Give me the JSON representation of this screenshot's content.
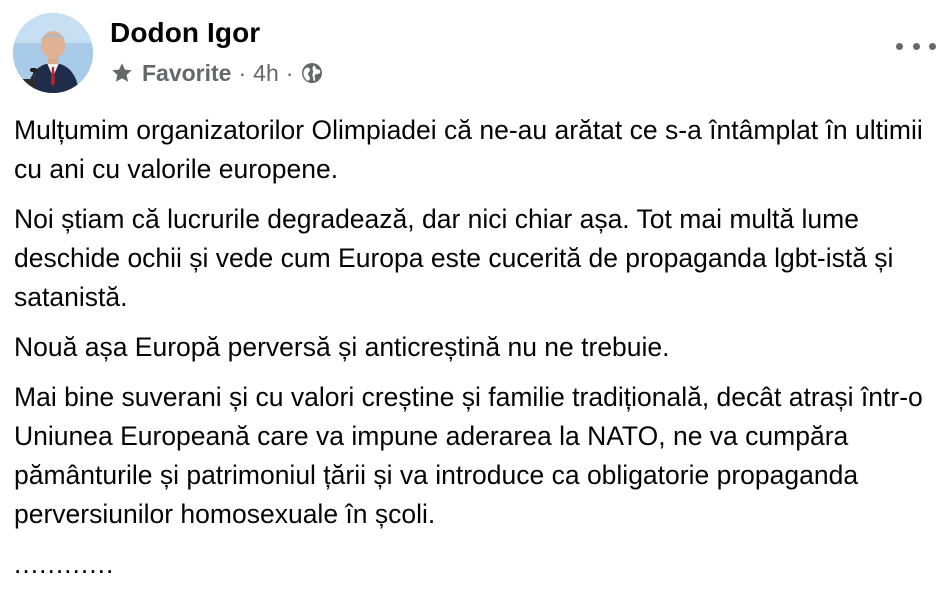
{
  "post": {
    "author": "Dodon Igor",
    "audience_label": "Favorite",
    "separator": "·",
    "time": "4h",
    "paragraphs": [
      "Mulțumim organizatorilor Olimpiadei că ne-au arătat ce s-a întâmplat în ultimii cu ani cu valorile europene.",
      "Noi știam că lucrurile degradează, dar nici chiar așa. Tot mai multă lume deschide ochii și vede cum Europa este cucerită de propaganda lgbt-istă și satanistă.",
      "Nouă așa Europă perversă și anticreștină nu ne trebuie.",
      "Mai bine suverani și cu valori creștine și familie tradițională, decât atrași într-o Uniunea Europeană care va impune aderarea la NATO, ne va cumpăra pământurile și patrimoniul țării și va introduce ca obligatorie propaganda perversiunilor homosexuale în școli."
    ],
    "trailing_dots": "............"
  },
  "icons": {
    "audience": "star-icon",
    "privacy": "globe-icon",
    "more": "more-options-icon"
  },
  "colors": {
    "text": "#050505",
    "secondary": "#65676b",
    "background": "#ffffff"
  }
}
